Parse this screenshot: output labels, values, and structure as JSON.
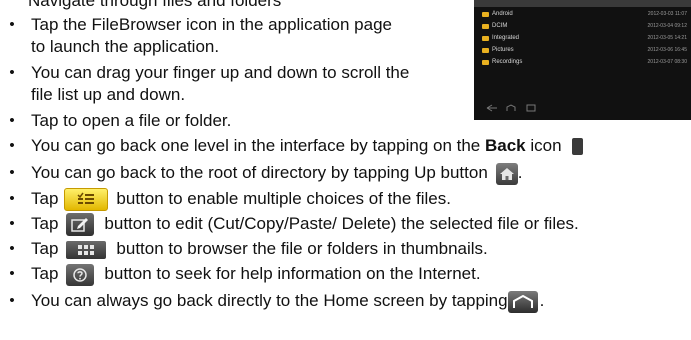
{
  "header": {
    "partial_text": "Navigate through files and folders"
  },
  "items": [
    {
      "lines": [
        "Tap the FileBrowser icon in the application page",
        "to launch the application."
      ]
    },
    {
      "lines": [
        "You can drag your finger up and down to scroll the",
        "file list up and down."
      ]
    },
    {
      "text": "Tap to open a file or folder."
    },
    {
      "before": "You can go back one level in the interface by tapping on the ",
      "bold": "Back",
      "after": " icon"
    },
    {
      "before": "You can go back to the root of directory by tapping Up button",
      "after": "."
    },
    {
      "before": "Tap",
      "after": "button to enable multiple choices of the files."
    },
    {
      "before": "Tap",
      "after": "button to edit (Cut/Copy/Paste/ Delete) the selected file or files."
    },
    {
      "before": "Tap",
      "after": "button to browser the file or folders in thumbnails."
    },
    {
      "before": "Tap",
      "after": "button to seek for help information on the Internet."
    },
    {
      "before": "You can always go back directly to the Home screen by tapping",
      "after": "."
    }
  ],
  "bullet_symbol": "•",
  "icons": {
    "back": "back-icon",
    "up": "up-home-icon",
    "multi_select": "multi-select-icon",
    "edit": "edit-icon",
    "thumbnails": "thumbnail-grid-icon",
    "help": "help-icon",
    "home": "home-screen-icon"
  },
  "screenshot": {
    "rows": [
      {
        "name": "Android",
        "date": "2012-03-03 11:07"
      },
      {
        "name": "DCIM",
        "date": "2012-03-04 09:12"
      },
      {
        "name": "Integrated",
        "date": "2012-03-05 14:21"
      },
      {
        "name": "Pictures",
        "date": "2012-03-06 16:45"
      },
      {
        "name": "Recordings",
        "date": "2012-03-07 08:30"
      }
    ]
  },
  "colors": {
    "multi_select_accent": "#f0c000",
    "folder": "#e8b020",
    "screenshot_bg": "#111111"
  }
}
